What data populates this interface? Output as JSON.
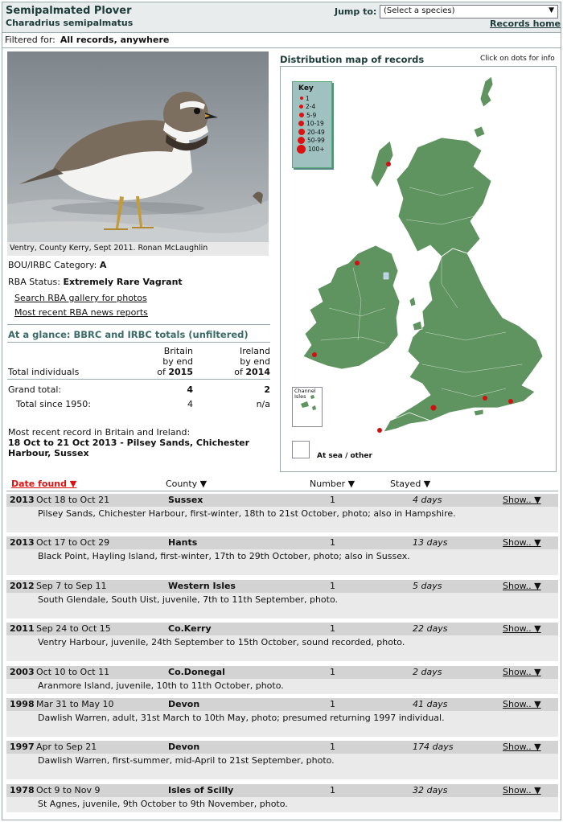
{
  "header": {
    "title": "Semipalmated Plover",
    "scientific": "Charadrius semipalmatus",
    "jump_label": "Jump to:",
    "jump_placeholder": "(Select a species)",
    "records_home": "Records home"
  },
  "filter": {
    "label": "Filtered for:",
    "value": "All records, anywhere"
  },
  "photo": {
    "caption": "Ventry, County Kerry, Sept 2011. Ronan McLaughlin"
  },
  "status": {
    "category_label": "BOU/IRBC Category:",
    "category_value": "A",
    "rba_label": "RBA Status:",
    "rba_value": "Extremely Rare Vagrant"
  },
  "links": {
    "gallery": "Search RBA gallery for photos",
    "news": "Most recent RBA news reports"
  },
  "glance": {
    "title": "At a glance: BBRC and IRBC totals (unfiltered)",
    "britain_head": [
      "Britain",
      "by end",
      "of"
    ],
    "britain_year": "2015",
    "ireland_head": [
      "Ireland",
      "by end",
      "of"
    ],
    "ireland_year": "2014",
    "total_individuals": "Total individuals",
    "grand_total_label": "Grand total:",
    "grand_britain": "4",
    "grand_ireland": "2",
    "since_label": "Total since 1950:",
    "since_britain": "4",
    "since_ireland": "n/a"
  },
  "recent": {
    "label": "Most recent record in Britain and Ireland:",
    "value": "18 Oct to 21 Oct 2013 - Pilsey Sands, Chichester Harbour, Sussex"
  },
  "map": {
    "title": "Distribution map of records",
    "hint": "Click on dots for info",
    "legend_title": "Key",
    "legend": [
      "1",
      "2-4",
      "5-9",
      "10-19",
      "20-49",
      "50-99",
      "100+"
    ],
    "channel_isles": "Channel Isles",
    "sea_label": "At sea / other",
    "land_color": "#5f9460",
    "dot_color": "#d11111"
  },
  "table": {
    "headers": {
      "date": "Date found ▼",
      "county": "County ▼",
      "number": "Number ▼",
      "stayed": "Stayed ▼"
    },
    "show_label": "Show.. ▼",
    "records": [
      {
        "year": "2013",
        "dates": "Oct 18 to Oct 21",
        "county": "Sussex",
        "number": "1",
        "stayed": "4 days",
        "desc": "Pilsey Sands, Chichester Harbour, first-winter, 18th to 21st October, photo; also in Hampshire."
      },
      {
        "year": "2013",
        "dates": "Oct 17 to Oct 29",
        "county": "Hants",
        "number": "1",
        "stayed": "13 days",
        "desc": "Black Point, Hayling Island, first-winter, 17th to 29th October, photo; also in Sussex."
      },
      {
        "year": "2012",
        "dates": "Sep 7 to Sep 11",
        "county": "Western Isles",
        "number": "1",
        "stayed": "5 days",
        "desc": "South Glendale, South Uist, juvenile, 7th to 11th September, photo."
      },
      {
        "year": "2011",
        "dates": "Sep 24 to Oct 15",
        "county": "Co.Kerry",
        "number": "1",
        "stayed": "22 days",
        "desc": "Ventry Harbour, juvenile, 24th September to 15th October, sound recorded, photo."
      },
      {
        "year": "2003",
        "dates": "Oct 10 to Oct 11",
        "county": "Co.Donegal",
        "number": "1",
        "stayed": "2 days",
        "desc": "Aranmore Island, juvenile, 10th to 11th October, photo."
      },
      {
        "year": "1998",
        "dates": "Mar 31 to May 10",
        "county": "Devon",
        "number": "1",
        "stayed": "41 days",
        "desc": "Dawlish Warren, adult, 31st March to 10th May, photo; presumed returning 1997 individual."
      },
      {
        "year": "1997",
        "dates": "Apr to Sep 21",
        "county": "Devon",
        "number": "1",
        "stayed": "174 days",
        "desc": "Dawlish Warren, first-summer, mid-April to 21st September, photo."
      },
      {
        "year": "1978",
        "dates": "Oct 9 to Nov 9",
        "county": "Isles of Scilly",
        "number": "1",
        "stayed": "32 days",
        "desc": "St Agnes, juvenile, 9th October to 9th November, photo."
      }
    ]
  }
}
